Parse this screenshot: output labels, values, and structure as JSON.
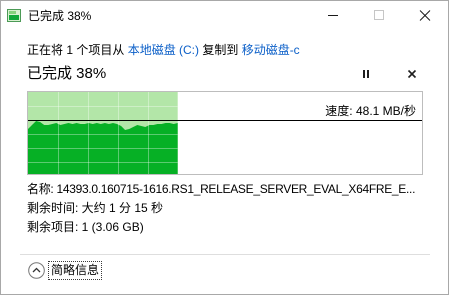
{
  "window": {
    "title": "已完成 38%",
    "title_icon": "file-copy-progress-icon",
    "minimize_icon": "minimize-icon",
    "maximize_icon": "maximize-icon",
    "close_icon": "close-icon",
    "maximize_enabled": false
  },
  "operation": {
    "prefix": "正在将 1 个项目从 ",
    "source": "本地磁盘 (C:)",
    "connector": " 复制到 ",
    "destination": "移动磁盘-c"
  },
  "progress": {
    "label": "已完成 38%",
    "percent": 38,
    "pause_icon": "pause-icon",
    "cancel_icon": "cancel-icon"
  },
  "graph": {
    "speed_label": "速度: 48.1 MB/秒",
    "current_speed_mbps": 48.1,
    "speed_history_mbps": [
      40.1,
      43.6,
      47.2,
      46.3,
      43.6,
      43.6,
      44.5,
      45.4,
      43.6,
      44.5,
      45.4,
      44.5,
      45.4,
      44.5,
      44.5,
      45.4,
      44.5,
      45.4,
      44.5,
      45.4,
      44.5,
      45.4,
      44.5,
      42.7,
      39.2,
      40.1,
      41.8,
      43.6,
      42.7,
      41.8,
      43.6,
      43.6,
      44.5,
      44.5,
      45.4,
      45.4,
      44.5,
      45.4
    ]
  },
  "details": {
    "name": "名称: 14393.0.160715-1616.RS1_RELEASE_SERVER_EVAL_X64FRE_E...",
    "time_remaining": "剩余时间: 大约 1 分 15 秒",
    "items_remaining": "剩余项目: 1 (3.06 GB)"
  },
  "footer": {
    "toggle_icon": "chevron-up-circle-icon",
    "toggle_label": "简略信息"
  },
  "colors": {
    "link": "#0b5fc8",
    "progress_light": "#b3e6a8",
    "progress_dark": "#06b025",
    "speed_line": "#000000"
  }
}
